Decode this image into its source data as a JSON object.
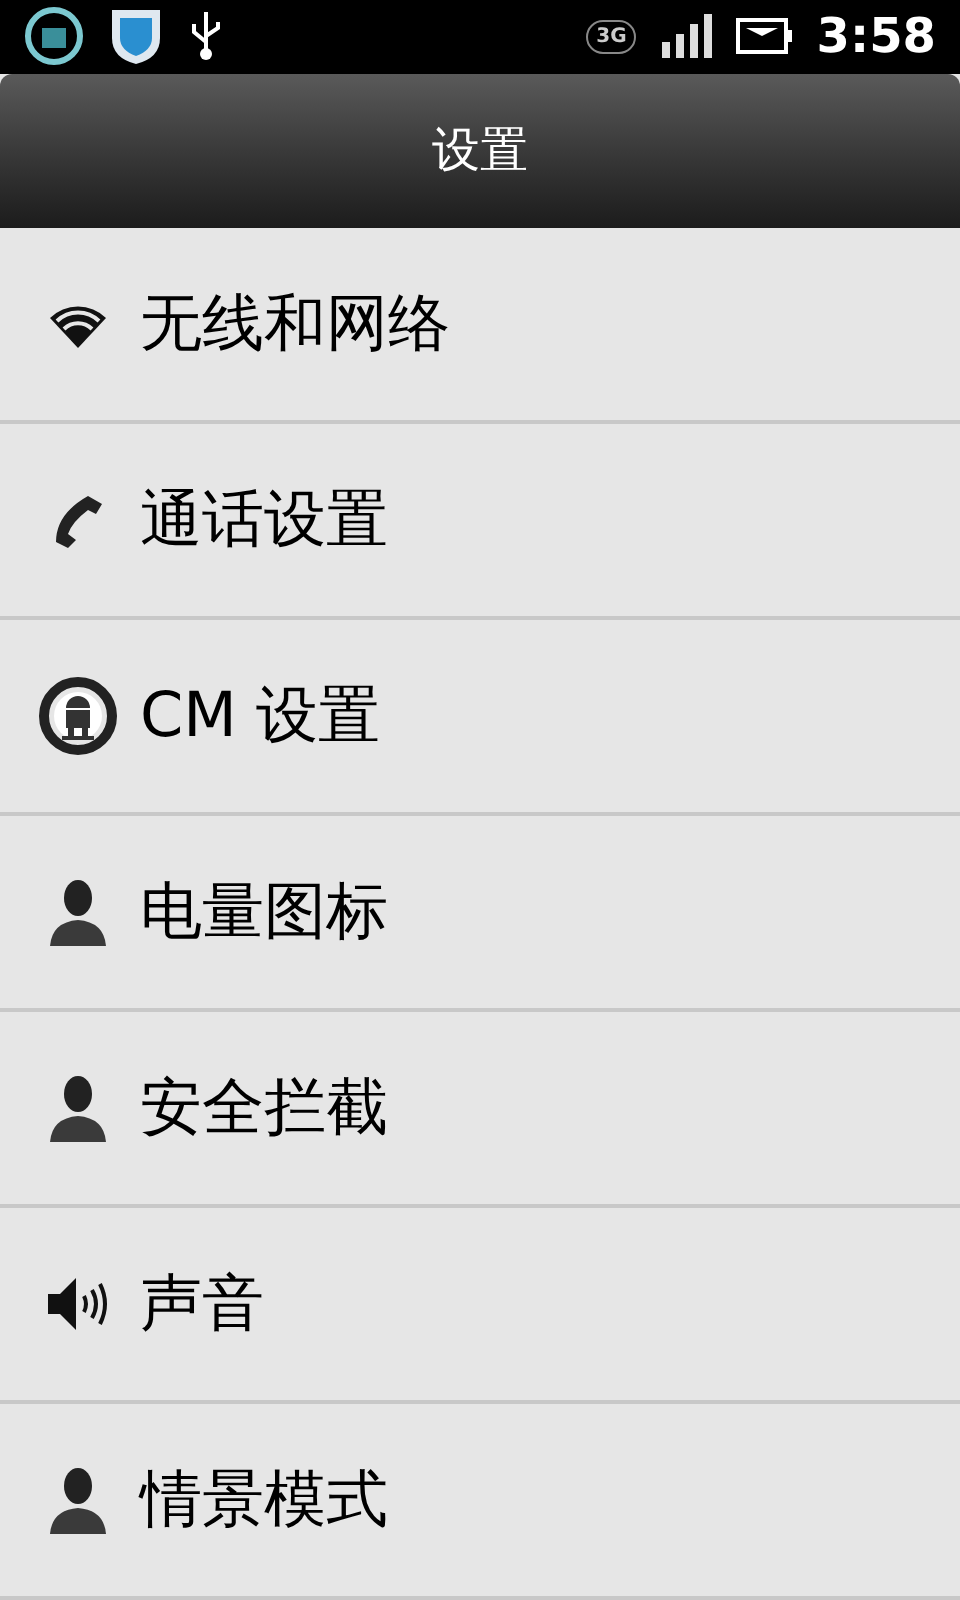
{
  "status_bar": {
    "time": "3:58",
    "network": "3G"
  },
  "title": "设置",
  "items": [
    {
      "label": "无线和网络",
      "kind": "wifi"
    },
    {
      "label": "通话设置",
      "kind": "phone"
    },
    {
      "label": "CM 设置",
      "kind": "cm"
    },
    {
      "label": "电量图标",
      "kind": "person"
    },
    {
      "label": "安全拦截",
      "kind": "person"
    },
    {
      "label": "声音",
      "kind": "sound"
    },
    {
      "label": "情景模式",
      "kind": "person"
    }
  ]
}
